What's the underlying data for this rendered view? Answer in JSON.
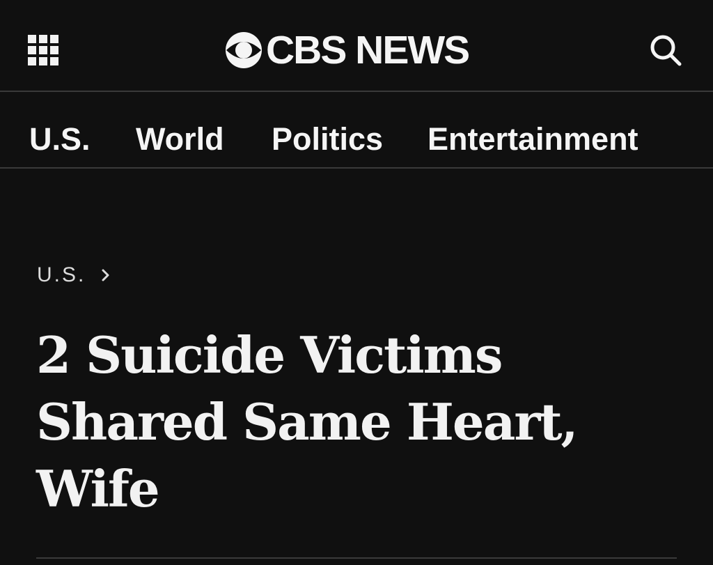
{
  "header": {
    "logo_text": "CBS NEWS",
    "menu_icon": "grid-menu-icon",
    "search_icon": "search-icon"
  },
  "nav": {
    "items": [
      {
        "label": "U.S."
      },
      {
        "label": "World"
      },
      {
        "label": "Politics"
      },
      {
        "label": "Entertainment"
      }
    ]
  },
  "article": {
    "breadcrumb": "U.S.",
    "headline": "2 Suicide Victims Shared Same Heart, Wife"
  },
  "colors": {
    "background": "#101010",
    "text": "#f2f2f2",
    "divider": "#3a3a3a"
  }
}
